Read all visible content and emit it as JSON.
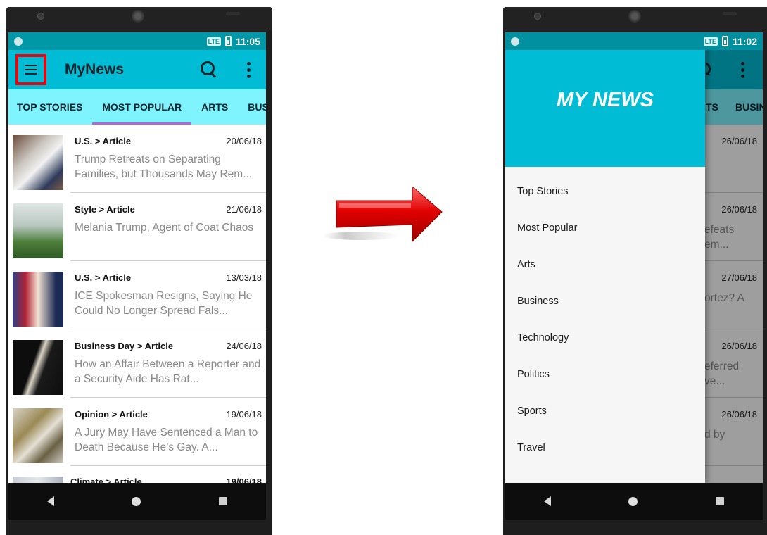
{
  "left_screen": {
    "status": {
      "time": "11:05",
      "network": "LTE"
    },
    "toolbar": {
      "title": "MyNews"
    },
    "tabs": [
      {
        "label": "TOP STORIES",
        "active": false
      },
      {
        "label": "MOST POPULAR",
        "active": true
      },
      {
        "label": "ARTS",
        "active": false
      },
      {
        "label": "BUSIN",
        "active": false
      }
    ],
    "articles": [
      {
        "section": "U.S. > Article",
        "date": "20/06/18",
        "title": "Trump Retreats on Separating Families, but Thousands May Rem..."
      },
      {
        "section": "Style > Article",
        "date": "21/06/18",
        "title": "Melania Trump, Agent of Coat Chaos"
      },
      {
        "section": "U.S. > Article",
        "date": "13/03/18",
        "title": "ICE Spokesman Resigns, Saying He Could No Longer Spread Fals..."
      },
      {
        "section": "Business Day > Article",
        "date": "24/06/18",
        "title": "How an Affair Between a Reporter and a Security Aide Has Rat..."
      },
      {
        "section": "Opinion > Article",
        "date": "19/06/18",
        "title": "A Jury May Have Sentenced a Man to Death Because He’s Gay. A..."
      }
    ],
    "partial_article": {
      "section": "Climate > Article",
      "date": "19/06/18"
    }
  },
  "right_screen": {
    "status": {
      "time": "11:02",
      "network": "LTE"
    },
    "drawer": {
      "title": "MY NEWS",
      "items": [
        "Top Stories",
        "Most Popular",
        "Arts",
        "Business",
        "Technology",
        "Politics",
        "Sports",
        "Travel"
      ]
    },
    "background": {
      "tabs": [
        "TS",
        "BUSIN"
      ],
      "rows": [
        {
          "date": "26/06/18",
          "title": ""
        },
        {
          "date": "26/06/18",
          "title": "efeats\nem..."
        },
        {
          "date": "27/06/18",
          "title": "ortez? A"
        },
        {
          "date": "26/06/18",
          "title": "eferred\nve..."
        },
        {
          "date": "26/06/18",
          "title": "d by"
        }
      ]
    }
  },
  "colors": {
    "primary": "#00bcd4",
    "primary_dark": "#0097a7",
    "tab_bar": "#7ff4ff",
    "tab_indicator": "#b265e0",
    "highlight": "#e30613"
  },
  "icons": {
    "menu": "hamburger-menu-icon",
    "search": "search-icon",
    "more": "more-vert-icon",
    "back": "nav-back-icon",
    "home": "nav-home-icon",
    "recent": "nav-recents-icon",
    "transition": "right-arrow-icon"
  }
}
